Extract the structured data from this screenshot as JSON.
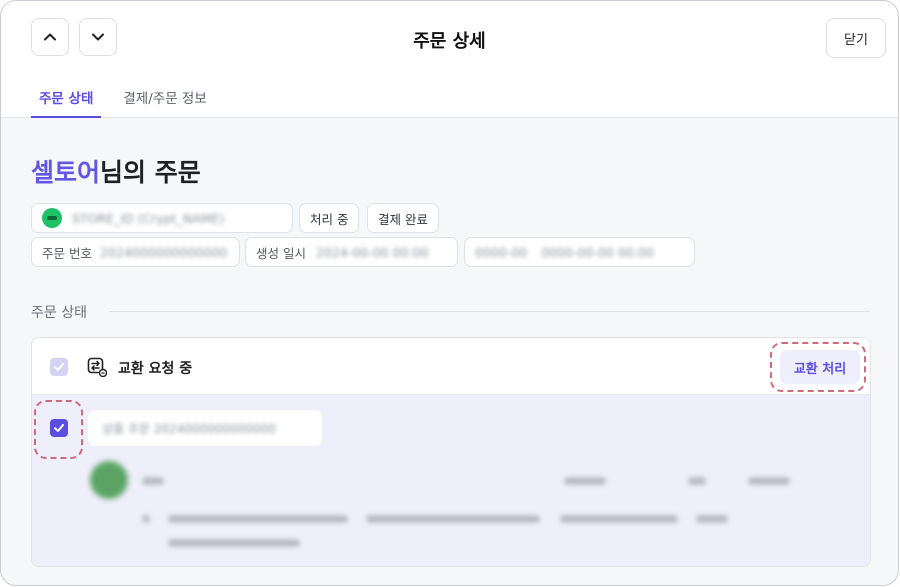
{
  "header": {
    "title": "주문 상세",
    "close_label": "닫기",
    "prev_icon": "chevron-up-icon",
    "next_icon": "chevron-down-icon"
  },
  "tabs": [
    {
      "label": "주문 상태",
      "active": true
    },
    {
      "label": "결제/주문 정보",
      "active": false
    }
  ],
  "customer": {
    "name": "셀토어",
    "suffix": "님의 주문"
  },
  "order_meta": {
    "store_text": "STORE_ID (Crypt_NAME)",
    "processing_badge": "처리 중",
    "payment_badge": "결제 완료",
    "order_number_label": "주문 번호",
    "order_number_value": "2024000000000000",
    "created_label": "생성 일시",
    "created_value": "2024-00-00 00:00",
    "extra_label": "0000-00",
    "extra_value": "0000-00-00 00:00"
  },
  "section": {
    "title": "주문 상태"
  },
  "status_panel": {
    "status_icon": "exchange-icon",
    "status_text": "교환 요청 중",
    "action_label": "교환 처리",
    "item_id_text": "상품 주문 2024000000000000",
    "colors": {
      "accent": "#5b4de0",
      "highlight_dash": "#d06a79",
      "panel_bg": "#efeffb"
    }
  }
}
